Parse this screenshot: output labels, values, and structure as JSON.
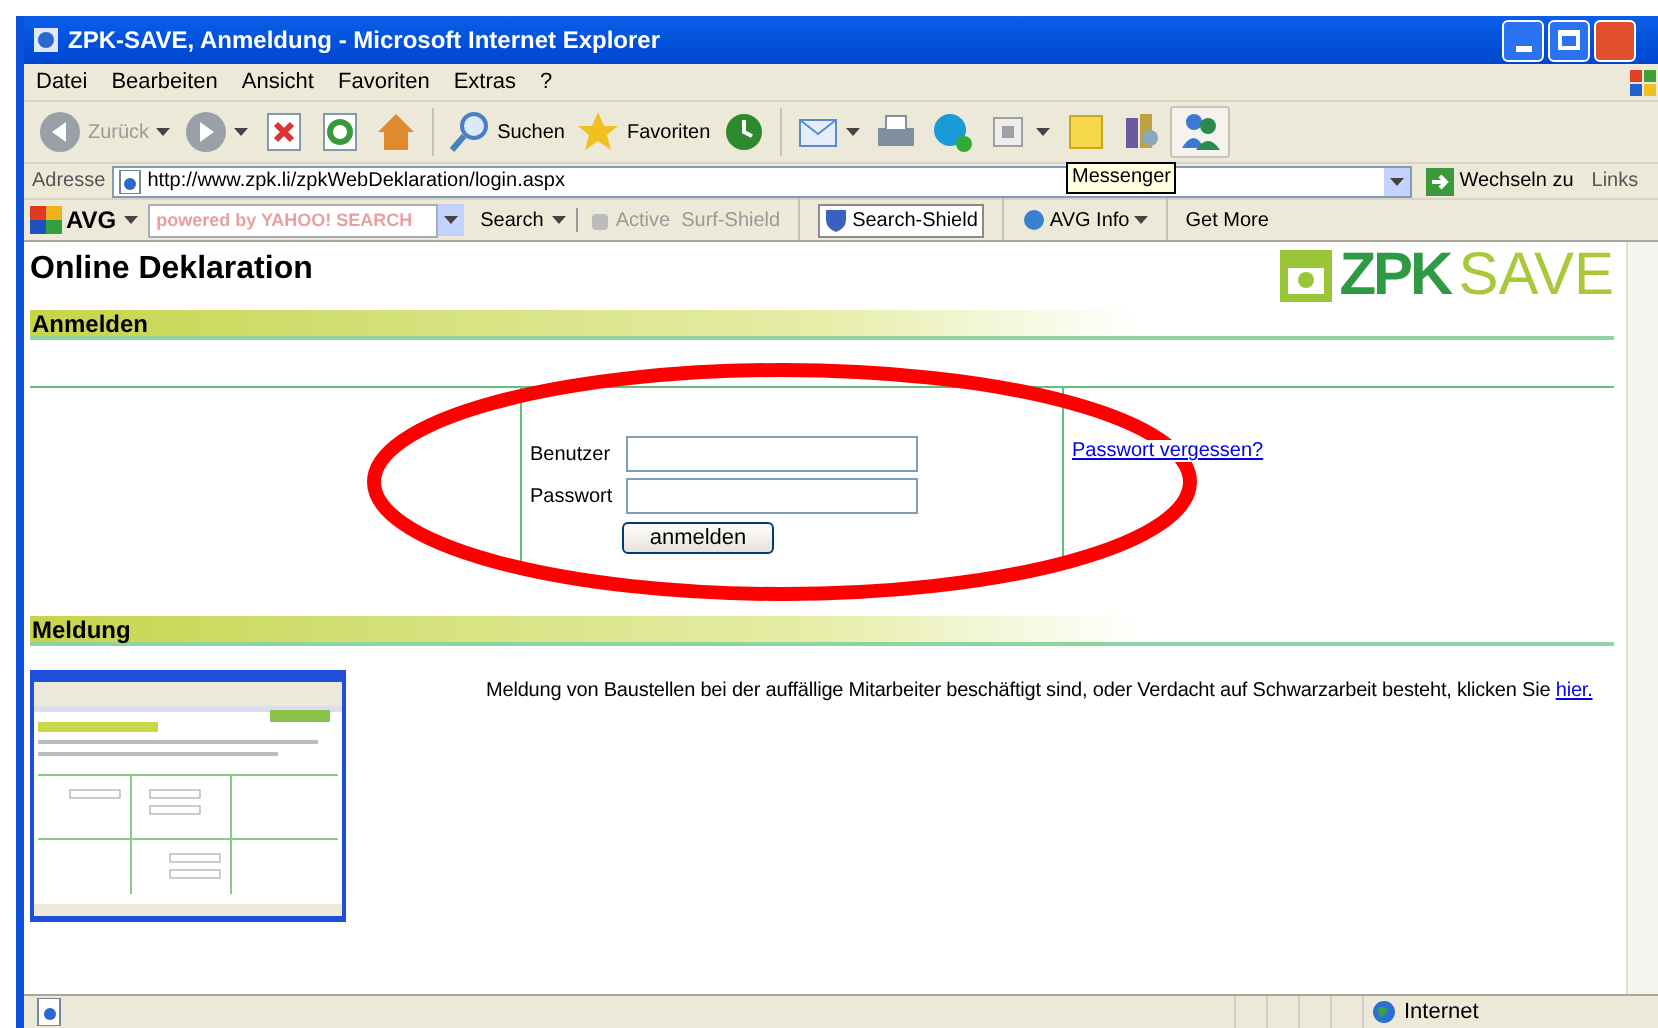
{
  "window": {
    "title": "ZPK-SAVE, Anmeldung - Microsoft Internet Explorer"
  },
  "menu": [
    "Datei",
    "Bearbeiten",
    "Ansicht",
    "Favoriten",
    "Extras",
    "?"
  ],
  "toolbar": [
    {
      "kind": "back",
      "label": "Zurück",
      "disabled": true
    },
    {
      "kind": "forward",
      "disabled": true
    },
    {
      "kind": "stop"
    },
    {
      "kind": "refresh"
    },
    {
      "kind": "home"
    },
    {
      "kind": "search",
      "label": "Suchen"
    },
    {
      "kind": "favorites",
      "label": "Favoriten"
    },
    {
      "kind": "history"
    },
    {
      "kind": "mail"
    },
    {
      "kind": "print"
    },
    {
      "kind": "skype"
    },
    {
      "kind": "media"
    },
    {
      "kind": "note"
    },
    {
      "kind": "research"
    },
    {
      "kind": "messenger"
    }
  ],
  "tooltip": "Messenger",
  "address": {
    "label": "Adresse",
    "value": "http://www.zpk.li/zpkWebDeklaration/login.aspx",
    "go": "Wechseln zu",
    "links": "Links"
  },
  "avg_bar": {
    "brand": "AVG",
    "search_placeholder": "powered by YAHOO! SEARCH",
    "search": "Search",
    "active_surf_shield": "Active  Surf-Shield",
    "search_shield": "Search-Shield",
    "avg_info": "AVG Info",
    "get_more": "Get More"
  },
  "page": {
    "title": "Online Deklaration",
    "logo_left": "ZPK",
    "logo_right": "SAVE",
    "login_section": "Anmelden",
    "user_label": "Benutzer",
    "password_label": "Passwort",
    "submit": "anmelden",
    "forgot_link": "Passwort vergessen?",
    "report_section": "Meldung",
    "report_text": "Meldung von Baustellen bei der auffällige Mitarbeiter beschäftigt sind, oder Verdacht auf Schwarzarbeit besteht, klicken Sie ",
    "report_link": "hier."
  },
  "status_bar": {
    "zone": "Internet"
  }
}
